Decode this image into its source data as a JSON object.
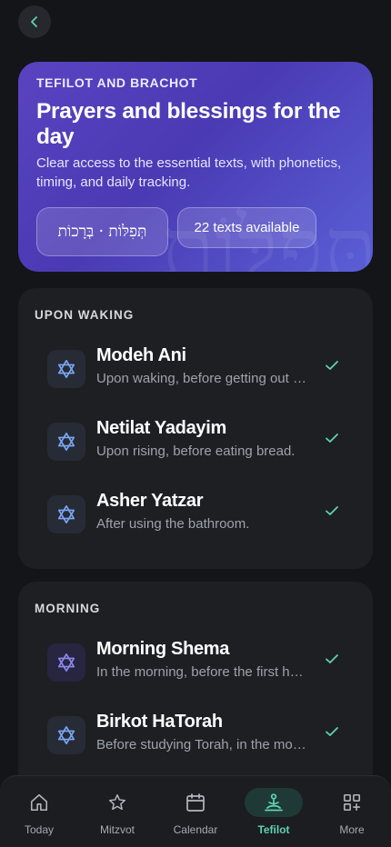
{
  "header": {
    "back_icon": "chevron-left-icon"
  },
  "hero": {
    "eyebrow": "TEFILOT AND BRACHOT",
    "title": "Prayers and blessings for the day",
    "description": "Clear access to the essential texts, with phonetics, timing, and daily tracking.",
    "hebrew_chip": "תְּפִלּוֹת · בְּרָכוֹת",
    "count_chip": "22 texts available",
    "watermark": "תְּפִלּוֹת"
  },
  "sections": [
    {
      "title": "UPON WAKING",
      "items": [
        {
          "name": "Modeh Ani",
          "sub": "Upon waking, before getting out of bed.",
          "icon": "star-of-david-icon",
          "done": true
        },
        {
          "name": "Netilat Yadayim",
          "sub": "Upon rising, before eating bread.",
          "icon": "star-of-david-icon",
          "done": true
        },
        {
          "name": "Asher Yatzar",
          "sub": "After using the bathroom.",
          "icon": "star-of-david-icon",
          "done": true
        }
      ]
    },
    {
      "title": "MORNING",
      "items": [
        {
          "name": "Morning Shema",
          "sub": "In the morning, before the first hours.",
          "icon": "star-of-david-icon",
          "done": true
        },
        {
          "name": "Birkot HaTorah",
          "sub": "Before studying Torah, in the morning.",
          "icon": "star-of-david-icon",
          "done": true
        }
      ]
    }
  ],
  "tabbar": {
    "tabs": [
      {
        "label": "Today",
        "icon": "home-icon"
      },
      {
        "label": "Mitzvot",
        "icon": "star-icon"
      },
      {
        "label": "Calendar",
        "icon": "calendar-icon"
      },
      {
        "label": "Tefilot",
        "icon": "prayer-icon"
      },
      {
        "label": "More",
        "icon": "grid-plus-icon"
      }
    ],
    "active": "Tefilot"
  },
  "colors": {
    "accent": "#5fd3b3",
    "hero_start": "#5a43c2",
    "hero_end": "#5a5fd6",
    "icon_blue": "#7aa6f5"
  }
}
